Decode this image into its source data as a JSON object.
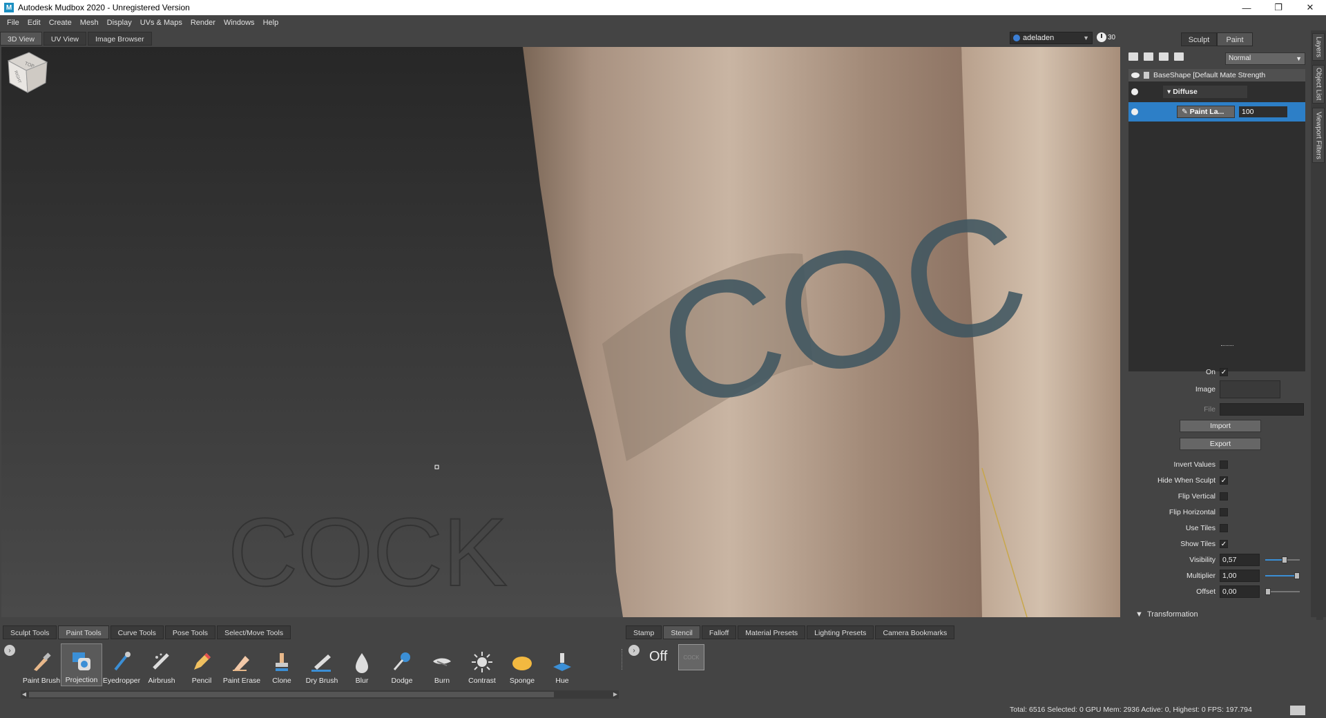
{
  "window": {
    "title": "Autodesk Mudbox 2020 - Unregistered Version",
    "app_icon_letter": "M",
    "controls": [
      "—",
      "❐",
      "✕"
    ]
  },
  "menu": [
    "File",
    "Edit",
    "Create",
    "Mesh",
    "Display",
    "UVs & Maps",
    "Render",
    "Windows",
    "Help"
  ],
  "view_tabs": [
    {
      "label": "3D View",
      "active": true
    },
    {
      "label": "UV View",
      "active": false
    },
    {
      "label": "Image Browser",
      "active": false
    }
  ],
  "account": {
    "user": "adeladen",
    "trial_days": "30"
  },
  "viewport": {
    "viewcube_faces": [
      "TOP",
      "RIGHT"
    ],
    "mesh_text": "COC",
    "stencil_ghost_text": "COCK"
  },
  "right_panel": {
    "tabs": [
      {
        "label": "Sculpt",
        "active": false
      },
      {
        "label": "Paint",
        "active": true
      }
    ],
    "blend_mode": "Normal",
    "base_layer": "BaseShape [Default Mate Strength",
    "channel": "Diffuse",
    "paint_layer": {
      "name": "Paint La...",
      "opacity": "100"
    },
    "vertical_tabs": [
      "Layers",
      "Object List",
      "Viewport Filters"
    ]
  },
  "stencil_props": {
    "on_label": "On",
    "on": true,
    "image_label": "Image",
    "file_label": "File",
    "import_label": "Import",
    "export_label": "Export",
    "invert_label": "Invert Values",
    "invert": false,
    "hide_label": "Hide When Sculpt",
    "hide": true,
    "flipv_label": "Flip Vertical",
    "flipv": false,
    "fliph_label": "Flip Horizontal",
    "fliph": false,
    "usetiles_label": "Use Tiles",
    "usetiles": false,
    "showtiles_label": "Show Tiles",
    "showtiles": true,
    "visibility_label": "Visibility",
    "visibility": "0,57",
    "visibility_level": 0.57,
    "multiplier_label": "Multiplier",
    "multiplier": "1,00",
    "multiplier_level": 1.0,
    "offset_label": "Offset",
    "offset": "0,00",
    "offset_level": 0.0,
    "transformation_label": "Transformation"
  },
  "tray_left_tabs": [
    {
      "label": "Sculpt Tools",
      "active": false
    },
    {
      "label": "Paint Tools",
      "active": true
    },
    {
      "label": "Curve Tools",
      "active": false
    },
    {
      "label": "Pose Tools",
      "active": false
    },
    {
      "label": "Select/Move Tools",
      "active": false
    }
  ],
  "tray_right_tabs": [
    {
      "label": "Stamp",
      "active": false
    },
    {
      "label": "Stencil",
      "active": true
    },
    {
      "label": "Falloff",
      "active": false
    },
    {
      "label": "Material Presets",
      "active": false
    },
    {
      "label": "Lighting Presets",
      "active": false
    },
    {
      "label": "Camera Bookmarks",
      "active": false
    }
  ],
  "paint_tools": [
    {
      "label": "Paint Brush",
      "icon": "paint-brush-icon",
      "active": false
    },
    {
      "label": "Projection",
      "icon": "projection-icon",
      "active": true
    },
    {
      "label": "Eyedropper",
      "icon": "eyedropper-icon",
      "active": false
    },
    {
      "label": "Airbrush",
      "icon": "airbrush-icon",
      "active": false
    },
    {
      "label": "Pencil",
      "icon": "pencil-icon",
      "active": false
    },
    {
      "label": "Paint Erase",
      "icon": "paint-erase-icon",
      "active": false
    },
    {
      "label": "Clone",
      "icon": "clone-icon",
      "active": false
    },
    {
      "label": "Dry Brush",
      "icon": "dry-brush-icon",
      "active": false
    },
    {
      "label": "Blur",
      "icon": "blur-icon",
      "active": false
    },
    {
      "label": "Dodge",
      "icon": "dodge-icon",
      "active": false
    },
    {
      "label": "Burn",
      "icon": "burn-icon",
      "active": false
    },
    {
      "label": "Contrast",
      "icon": "contrast-icon",
      "active": false
    },
    {
      "label": "Sponge",
      "icon": "sponge-icon",
      "active": false
    },
    {
      "label": "Hue",
      "icon": "hue-icon",
      "active": false
    }
  ],
  "stencil_tray": {
    "state": "Off",
    "thumb_text": "COCK"
  },
  "status": "Total: 6516  Selected: 0 GPU Mem: 2936  Active: 0, Highest: 0  FPS: 197.794",
  "colors": {
    "accent": "#2d7fc7",
    "panel": "#444444",
    "skin": "#b79a82"
  }
}
